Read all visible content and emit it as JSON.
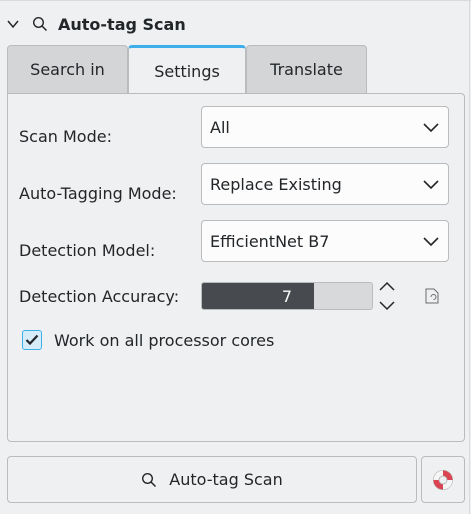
{
  "header": {
    "title": "Auto-tag Scan"
  },
  "tabs": [
    {
      "label": "Search in"
    },
    {
      "label": "Settings"
    },
    {
      "label": "Translate"
    }
  ],
  "settings": {
    "scan_mode": {
      "label": "Scan Mode:",
      "value": "All"
    },
    "tagging_mode": {
      "label": "Auto-Tagging Mode:",
      "value": "Replace Existing"
    },
    "detection_model": {
      "label": "Detection Model:",
      "value": "EfficientNet B7"
    },
    "detection_accuracy": {
      "label": "Detection Accuracy:",
      "value": "7",
      "fraction": 0.66
    },
    "all_cores": {
      "label": "Work on all processor cores",
      "checked": true
    }
  },
  "actions": {
    "scan_label": "Auto-tag Scan"
  },
  "colors": {
    "accent": "#3daee9",
    "slider_fill": "#474b4f"
  }
}
